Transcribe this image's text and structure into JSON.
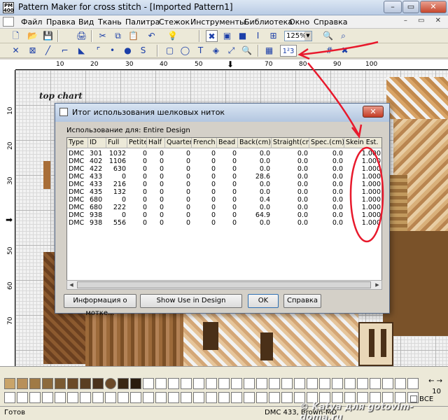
{
  "window": {
    "title": "Pattern Maker for cross stitch - [Imported Pattern1]",
    "icon_text": "PM 400",
    "buttons": [
      "–",
      "▭",
      "✕"
    ]
  },
  "menu": {
    "items": [
      "Файл",
      "Правка",
      "Вид",
      "Ткань",
      "Палитра",
      "Стежок",
      "Инструменты",
      "Библиотека",
      "Окно",
      "Справка"
    ],
    "mdi": "– ▭ ✕"
  },
  "toolbar": {
    "zoom_value": "125%",
    "top_glyphs": [
      "🗋",
      "📂",
      "💾",
      "🖨",
      "✂",
      "⧉",
      "📋",
      "↶",
      "💡",
      "✖",
      "▣",
      "■",
      "I",
      "⊞",
      "🔍"
    ],
    "bottom_glyphs": [
      "✕",
      "⊠",
      "╱",
      "⌐",
      "◣",
      "⌜",
      "•",
      "●",
      "S",
      "▢",
      "◯",
      "T",
      "◈",
      "⤢",
      "🔍",
      "▦",
      "1²3",
      "#",
      "✖"
    ]
  },
  "ruler": {
    "top": [
      "10",
      "20",
      "30",
      "40",
      "50",
      "60",
      "70",
      "80",
      "90",
      "100"
    ],
    "left": [
      "10",
      "20",
      "30",
      "40",
      "50",
      "60",
      "70"
    ]
  },
  "chart": {
    "label": "top chart"
  },
  "dialog": {
    "title": "Итог использования шелковых ниток",
    "usage_for": "Использование для: Entire Design",
    "columns": [
      "Type",
      "ID",
      "Full",
      "Petite",
      "Half",
      "Quarter",
      "French",
      "Bead",
      "Back(cm)",
      "Straight(cm)",
      "Spec.(cm)",
      "Skein Est."
    ],
    "rows": [
      [
        "DMC",
        "301",
        "1032",
        "0",
        "0",
        "0",
        "0",
        "0",
        "0.0",
        "0.0",
        "0.0",
        "1.000"
      ],
      [
        "DMC",
        "402",
        "1106",
        "0",
        "0",
        "0",
        "0",
        "0",
        "0.0",
        "0.0",
        "0.0",
        "1.000"
      ],
      [
        "DMC",
        "422",
        "630",
        "0",
        "0",
        "0",
        "0",
        "0",
        "0.0",
        "0.0",
        "0.0",
        "1.000"
      ],
      [
        "DMC",
        "433",
        "0",
        "0",
        "0",
        "0",
        "0",
        "0",
        "28.6",
        "0.0",
        "0.0",
        "1.000"
      ],
      [
        "DMC",
        "433",
        "216",
        "0",
        "0",
        "0",
        "0",
        "0",
        "0.0",
        "0.0",
        "0.0",
        "1.000"
      ],
      [
        "DMC",
        "435",
        "132",
        "0",
        "0",
        "0",
        "0",
        "0",
        "0.0",
        "0.0",
        "0.0",
        "1.000"
      ],
      [
        "DMC",
        "680",
        "0",
        "0",
        "0",
        "0",
        "0",
        "0",
        "0.4",
        "0.0",
        "0.0",
        "1.000"
      ],
      [
        "DMC",
        "680",
        "222",
        "0",
        "0",
        "0",
        "0",
        "0",
        "0.0",
        "0.0",
        "0.0",
        "1.000"
      ],
      [
        "DMC",
        "938",
        "0",
        "0",
        "0",
        "0",
        "0",
        "0",
        "64.9",
        "0.0",
        "0.0",
        "1.000"
      ],
      [
        "DMC",
        "938",
        "556",
        "0",
        "0",
        "0",
        "0",
        "0",
        "0.0",
        "0.0",
        "0.0",
        "1.000"
      ]
    ],
    "buttons": {
      "info": "Информация о мотке...",
      "show_use": "Show Use in Design",
      "ok": "OK",
      "help": "Справка"
    }
  },
  "palette": {
    "colors": [
      "#c9a46a",
      "#b8905a",
      "#a07a45",
      "#8c6a3c",
      "#7a5a32",
      "#6b4a28",
      "#5a3e22",
      "#4a321c",
      "#6b4a28",
      "#3a2814",
      "#2a1c0e",
      "#ffffff",
      "#ffffff",
      "#ffffff",
      "#ffffff",
      "#ffffff",
      "#ffffff",
      "#ffffff",
      "#ffffff",
      "#ffffff",
      "#ffffff",
      "#ffffff",
      "#ffffff",
      "#ffffff",
      "#ffffff",
      "#ffffff",
      "#ffffff",
      "#ffffff",
      "#ffffff",
      "#ffffff",
      "#ffffff",
      "#ffffff",
      "#ffffff"
    ],
    "arrows": "← →",
    "count": "10",
    "all_label": "ВСЕ"
  },
  "status": {
    "ready": "Готов",
    "thread": "DMC 433, Brown-MD",
    "watermark": "© Katya для gotovim-doma.ru"
  },
  "accent": {
    "annotation_red": "#e8192c"
  }
}
